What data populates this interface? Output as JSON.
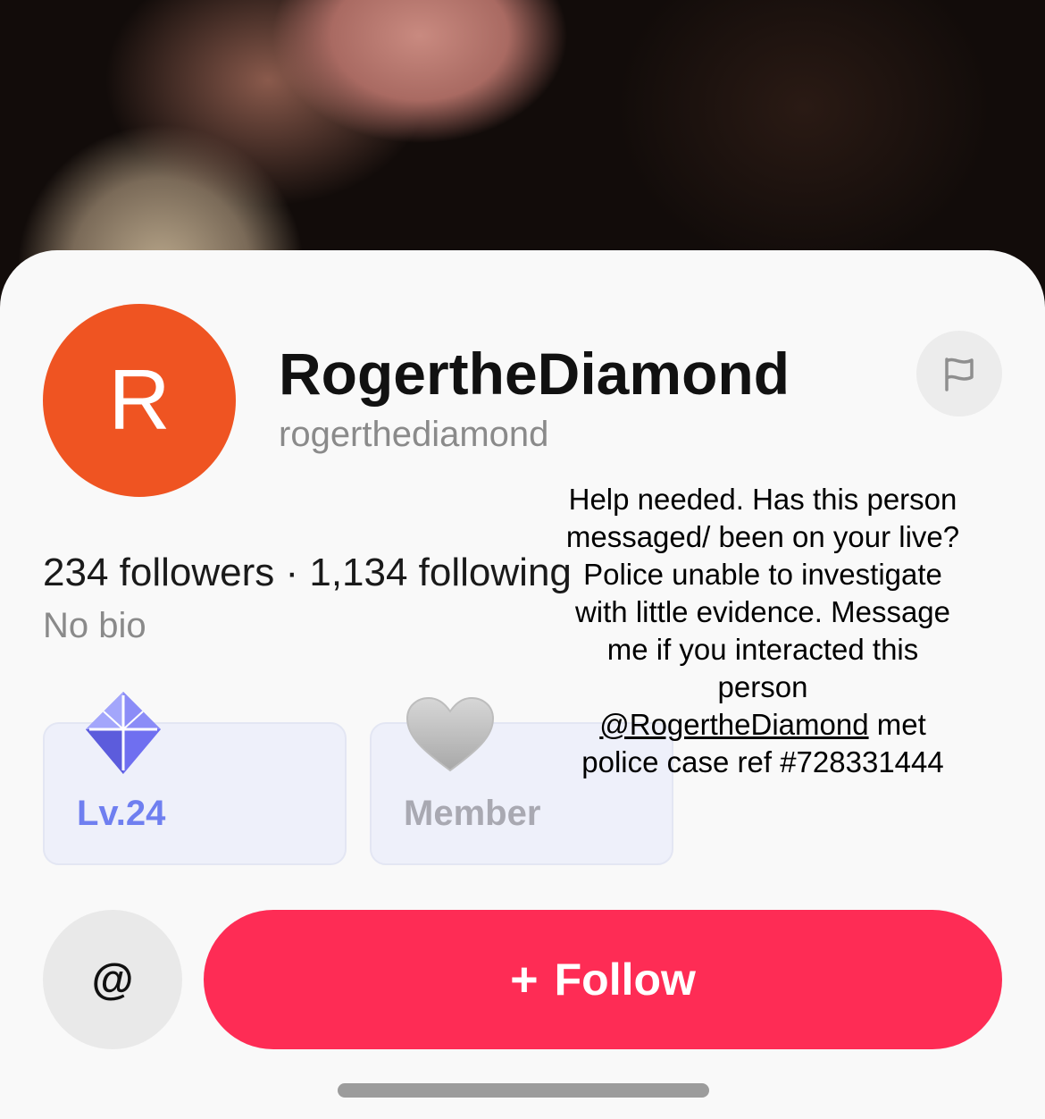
{
  "profile": {
    "avatar_letter": "R",
    "display_name": "RogertheDiamond",
    "username": "rogerthediamond",
    "stats": "234 followers · 1,134 following",
    "bio": "No bio"
  },
  "badges": {
    "level": {
      "label": "Lv.24",
      "icon": "diamond-icon"
    },
    "member": {
      "label": "Member",
      "icon": "heart-icon"
    }
  },
  "overlay": {
    "line_before": "Help needed. Has this person messaged/ been on your live? Police unable to investigate with little evidence. Message me if you interacted this person",
    "mention": "@RogertheDiamond",
    "line_after": " met police case ref #728331444"
  },
  "actions": {
    "mention_label": "@",
    "follow_plus": "+",
    "follow_label": "Follow"
  },
  "icons": {
    "report": "flag-icon"
  },
  "colors": {
    "avatar": "#ef5422",
    "follow": "#fe2c55",
    "level_text": "#6f7ff0",
    "member_text": "#a9a9b2"
  }
}
